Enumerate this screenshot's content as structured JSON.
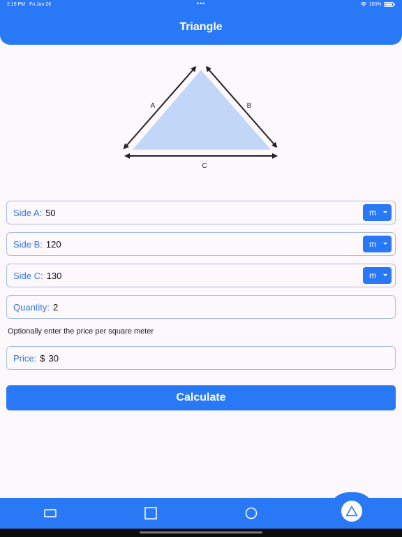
{
  "status": {
    "time": "2:19 PM",
    "date": "Fri Jan 26",
    "dots": "•••",
    "battery": "100%"
  },
  "header": {
    "title": "Triangle"
  },
  "diagram": {
    "label_a": "A",
    "label_b": "B",
    "label_c": "C",
    "fill_color": "#c2d6f7"
  },
  "fields": {
    "side_a": {
      "label": "Side A:",
      "value": "50",
      "unit": "m"
    },
    "side_b": {
      "label": "Side B:",
      "value": "120",
      "unit": "m"
    },
    "side_c": {
      "label": "Side C:",
      "value": "130",
      "unit": "m"
    },
    "quantity": {
      "label": "Quantity:",
      "value": "2"
    },
    "price": {
      "label": "Price:",
      "prefix": "$",
      "value": "30"
    }
  },
  "hint": "Optionally enter the price per square meter",
  "calculate_label": "Calculate",
  "nav": {
    "items": [
      "rectangle-icon",
      "square-icon",
      "circle-icon",
      "triangle-icon"
    ],
    "active": "triangle-icon"
  },
  "colors": {
    "accent": "#2979f6",
    "label": "#2f77e6",
    "border": "#a9bde3",
    "background": "#fdf8fb"
  }
}
